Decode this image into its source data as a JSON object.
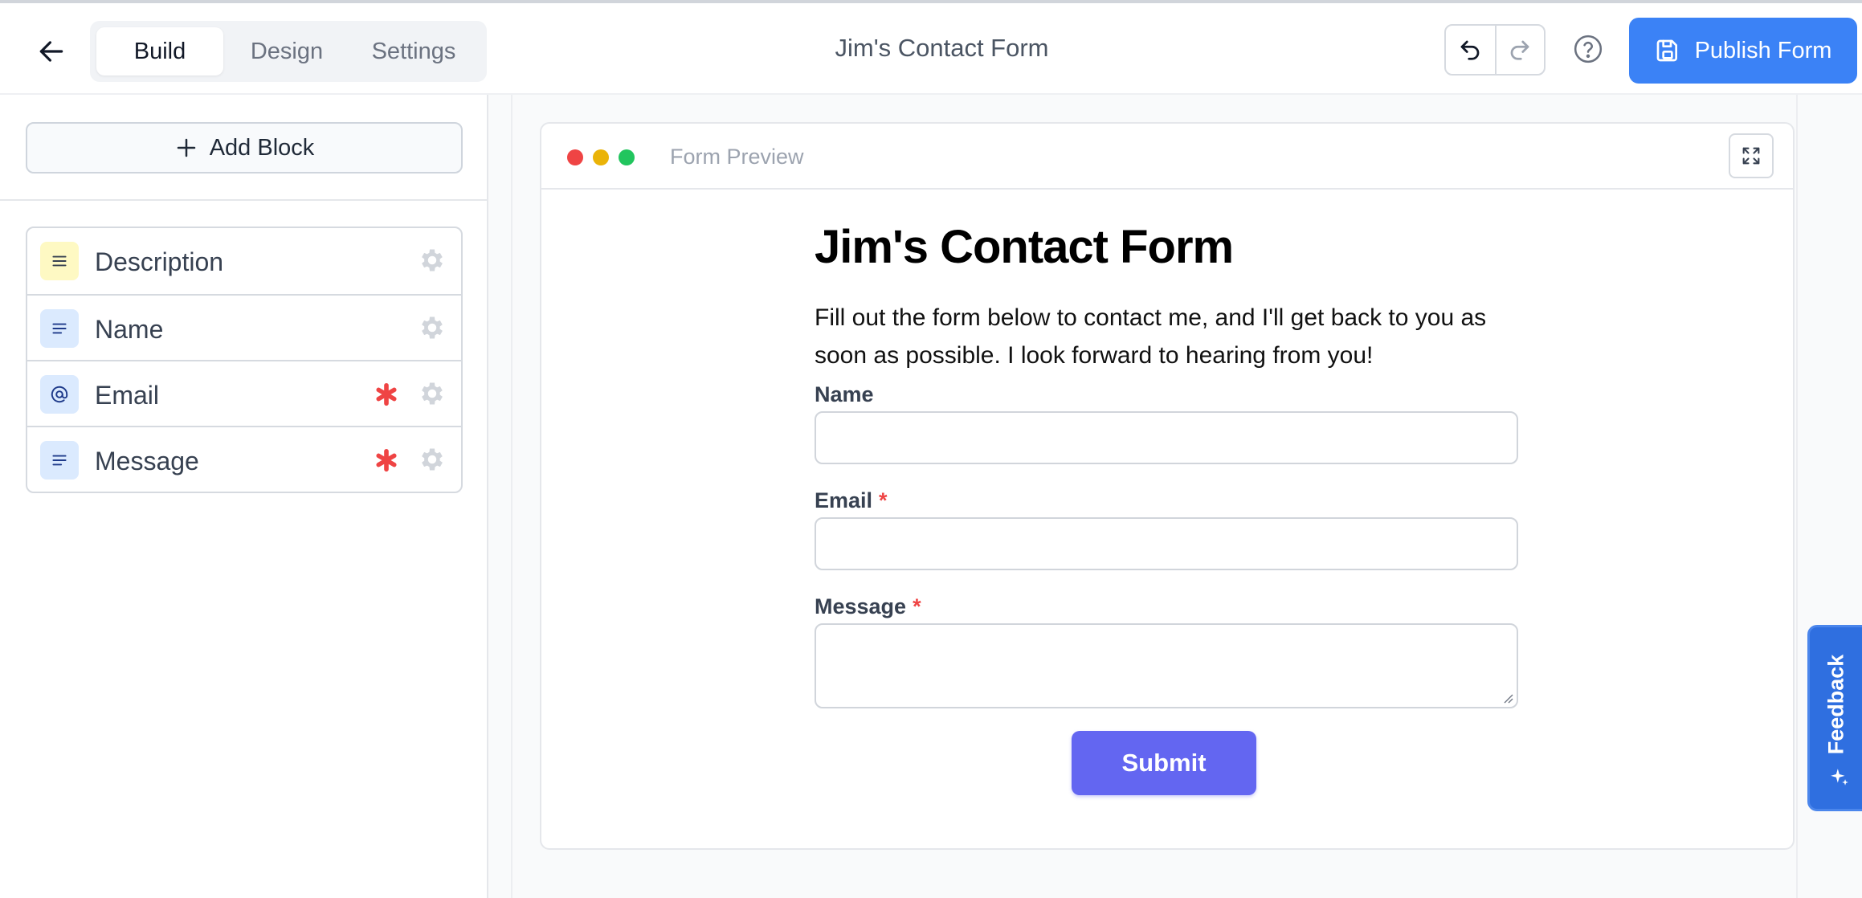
{
  "header": {
    "tabs": [
      {
        "label": "Build",
        "active": true
      },
      {
        "label": "Design",
        "active": false
      },
      {
        "label": "Settings",
        "active": false
      }
    ],
    "title": "Jim's Contact Form",
    "publish_label": "Publish Form",
    "icons": {
      "back": "arrow-left-icon",
      "undo": "undo-icon",
      "redo": "redo-icon",
      "help": "question-circle-icon",
      "publish": "save-icon"
    },
    "accent_color": "#3b82f6"
  },
  "sidebar": {
    "add_block_label": "Add Block",
    "blocks": [
      {
        "label": "Description",
        "icon": "text-lines-icon",
        "required": false
      },
      {
        "label": "Name",
        "icon": "text-short-icon",
        "required": false
      },
      {
        "label": "Email",
        "icon": "at-sign-icon",
        "required": true
      },
      {
        "label": "Message",
        "icon": "text-short-icon",
        "required": true
      }
    ]
  },
  "preview": {
    "header_label": "Form Preview",
    "form": {
      "title": "Jim's Contact Form",
      "description": "Fill out the form below to contact me, and I'll get back to you as soon as possible. I look forward to hearing from you!",
      "fields": [
        {
          "label": "Name",
          "required": false,
          "value": ""
        },
        {
          "label": "Email",
          "required": true,
          "value": ""
        },
        {
          "label": "Message",
          "required": true,
          "value": ""
        }
      ],
      "required_marker": "*",
      "submit_label": "Submit",
      "submit_color": "#6366f1"
    }
  },
  "feedback": {
    "label": "Feedback"
  }
}
